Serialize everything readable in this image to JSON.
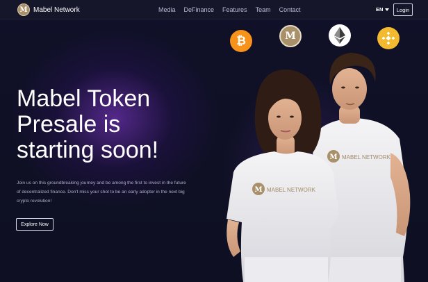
{
  "nav": {
    "brand_logo_letter": "M",
    "brand_name": "Mabel Network",
    "links": [
      "Media",
      "DeFinance",
      "Features",
      "Team",
      "Contact"
    ],
    "language": "EN",
    "login_label": "Login"
  },
  "coins": [
    "bitcoin-icon",
    "mabel-token-icon",
    "ethereum-icon",
    "binance-coin-icon"
  ],
  "coin_btc_symbol": "₿",
  "coin_mabel_symbol": "M",
  "hero": {
    "title_lines": [
      "Mabel Token",
      "Presale is",
      "starting soon!"
    ],
    "description_lines": [
      "Join us on this groundbreaking journey and be among the first to invest in the future",
      "of decentralized finance. Don't miss your shot to be an early adopter in the next big",
      "crypto revolution!"
    ],
    "cta_label": "Explore Now"
  },
  "photo": {
    "shirt_text": "MABEL NETWORK",
    "shirt_logo_letter": "M"
  },
  "colors": {
    "background": "#0f1022",
    "nav_background": "#15162a",
    "bitcoin": "#f7931a",
    "binance": "#f3ba2f",
    "mabel_gold": "#a8906a",
    "glow": "#8c3cdc"
  }
}
